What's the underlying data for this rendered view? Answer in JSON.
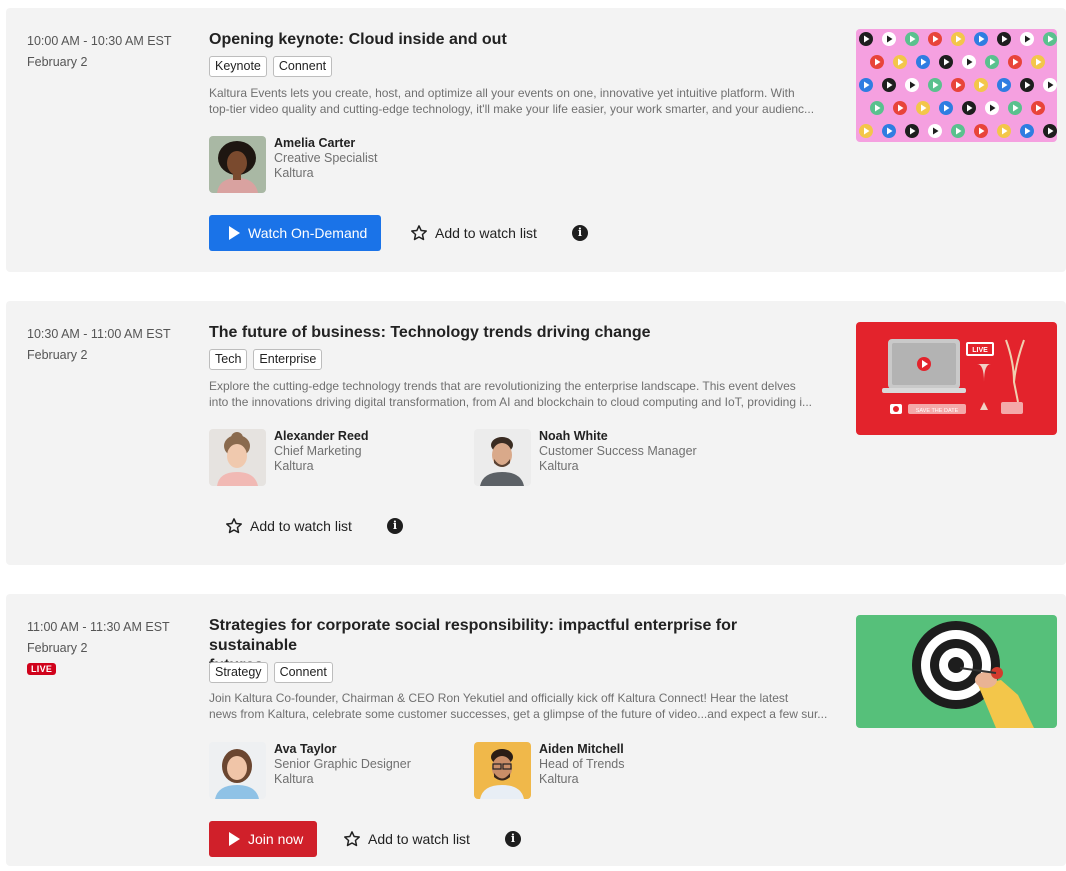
{
  "sessions": [
    {
      "time": "10:00 AM - 10:30 AM EST",
      "date": "February 2",
      "title": "Opening keynote: Cloud inside and out",
      "tags": [
        "Keynote",
        "Connent"
      ],
      "description": [
        "Kaltura Events lets you create, host, and optimize all your events on one, innovative yet intuitive platform. With",
        "top-tier video quality and cutting-edge technology, it'll make your life easier, your work smarter, and your audienc..."
      ],
      "speakers": [
        {
          "name": "Amelia Carter",
          "role": "Creative Specialist",
          "org": "Kaltura"
        }
      ],
      "primary_button": "Watch On-Demand",
      "watchlist": "Add to watch list"
    },
    {
      "time": "10:30 AM - 11:00 AM EST",
      "date": "February 2",
      "title": "The future of business: Technology trends driving change",
      "tags": [
        "Tech",
        "Enterprise"
      ],
      "description": [
        "Explore the cutting-edge technology trends that are revolutionizing the enterprise landscape. This event delves",
        "into the innovations driving digital transformation, from AI and blockchain to cloud computing and IoT, providing i..."
      ],
      "speakers": [
        {
          "name": "Alexander Reed",
          "role": "Chief Marketing",
          "org": "Kaltura"
        },
        {
          "name": "Noah White",
          "role": "Customer Success Manager",
          "org": "Kaltura"
        }
      ],
      "watchlist": "Add to watch list",
      "thumb_labels": {
        "live": "LIVE",
        "save": "SAVE THE DATE"
      }
    },
    {
      "time": "11:00 AM - 11:30 AM EST",
      "date": "February 2",
      "live": "LIVE",
      "title_lines": [
        "Strategies for corporate social responsibility: impactful enterprise for sustainable",
        "futures"
      ],
      "tags": [
        "Strategy",
        "Connent"
      ],
      "description": [
        "Join Kaltura Co-founder, Chairman & CEO Ron Yekutiel and officially kick off Kaltura Connect! Hear the latest",
        "news from Kaltura, celebrate some customer successes, get a glimpse of the future of video...and expect a few sur..."
      ],
      "speakers": [
        {
          "name": "Ava Taylor",
          "role": "Senior Graphic Designer",
          "org": "Kaltura"
        },
        {
          "name": "Aiden Mitchell",
          "role": "Head of Trends",
          "org": "Kaltura"
        }
      ],
      "primary_button": "Join now",
      "watchlist": "Add to watch list"
    }
  ],
  "icons": {
    "info": "info-icon",
    "star": "star-outline-icon",
    "play": "play-icon"
  },
  "colors": {
    "blue_button": "#1a73e8",
    "red_button": "#d0202a",
    "live_badge": "#d0021b",
    "card_bg": "#f3f3f3"
  }
}
